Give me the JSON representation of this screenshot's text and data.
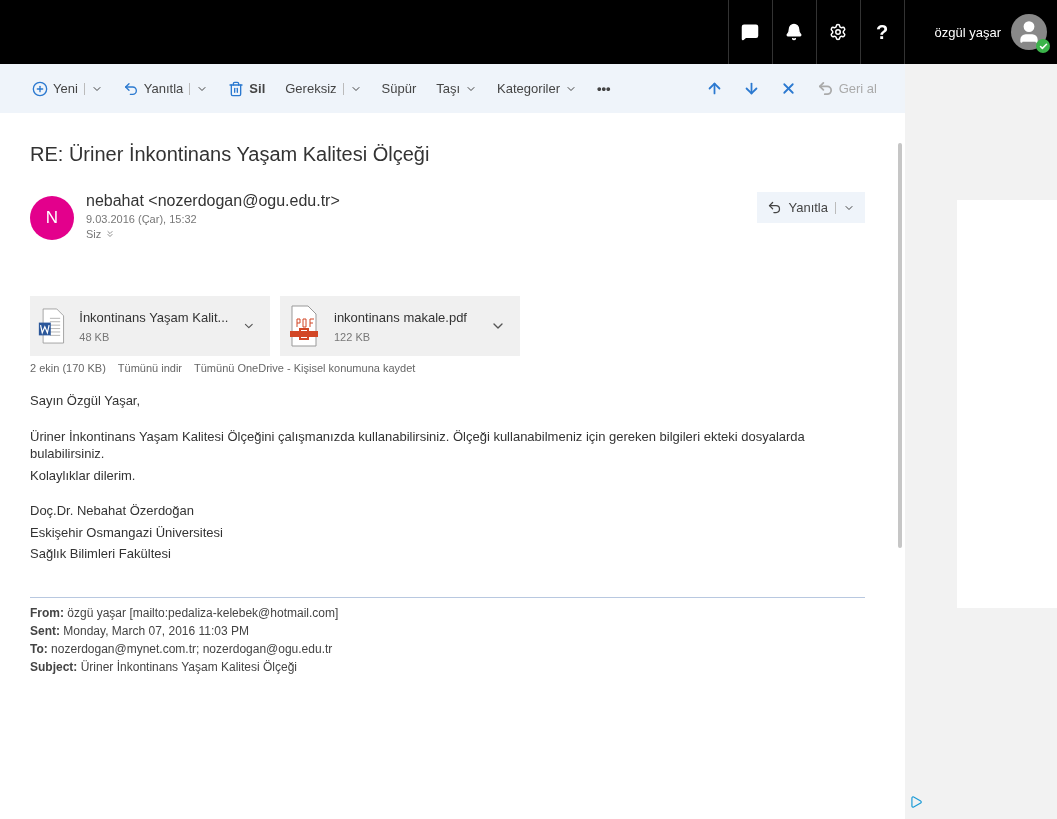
{
  "top_bar": {
    "buttons": [
      {
        "kind": "chat"
      },
      {
        "kind": "bell"
      },
      {
        "kind": "gear"
      },
      {
        "kind": "help",
        "text": "?"
      }
    ],
    "user_name": "özgül yaşar",
    "online": true
  },
  "toolbar": {
    "items": [
      {
        "kind": "new",
        "label": "Yeni",
        "has_menu": true,
        "split": true
      },
      {
        "kind": "reply",
        "label": "Yanıtla",
        "has_menu": true,
        "split": true
      },
      {
        "kind": "delete",
        "label": "Sil",
        "has_menu": false,
        "split": false
      },
      {
        "kind": "plain",
        "label": "Gereksiz",
        "has_menu": true,
        "split": true
      },
      {
        "kind": "plain",
        "label": "Süpür",
        "has_menu": false,
        "split": false
      },
      {
        "kind": "plain",
        "label": "Taşı",
        "has_menu": true,
        "split": false
      },
      {
        "kind": "plain",
        "label": "Kategoriler",
        "has_menu": true,
        "split": false
      },
      {
        "kind": "plain",
        "label": "•••",
        "has_menu": false,
        "split": false
      }
    ],
    "nav": [
      {
        "kind": "up",
        "disabled": false
      },
      {
        "kind": "down",
        "disabled": false
      },
      {
        "kind": "close",
        "disabled": false
      },
      {
        "kind": "undo",
        "label": "Geri al",
        "disabled": true
      }
    ]
  },
  "message": {
    "subject": "RE: Üriner İnkontinans Yaşam Kalitesi Ölçeği",
    "sender": {
      "initial": "N",
      "from": "nebahat <nozerdogan@ogu.edu.tr>",
      "date": "9.03.2016 (Çar), 15:32",
      "to": "Siz"
    },
    "reply_button": "Yanıtla",
    "attachments": [
      {
        "kind": "word",
        "name": "İnkontinans Yaşam Kalit...",
        "size": "48 KB"
      },
      {
        "kind": "pdf",
        "name": "inkontinans makale.pdf",
        "size": "122 KB"
      }
    ],
    "attachment_summary": "2 ekin (170 KB)",
    "attachment_actions": [
      "Tümünü indir",
      "Tümünü OneDrive - Kişisel konumuna kaydet"
    ],
    "body": [
      [
        "Sayın Özgül Yaşar,"
      ],
      [
        "Üriner İnkontinans Yaşam Kalitesi Ölçeğini çalışmanızda kullanabilirsiniz. Ölçeği kullanabilmeniz için gereken bilgileri ekteki dosyalarda bulabilirsiniz.",
        "Kolaylıklar dilerim."
      ],
      [
        "Doç.Dr. Nebahat Özerdoğan",
        "Eskişehir Osmangazi Üniversitesi",
        "Sağlık Bilimleri Fakültesi"
      ]
    ],
    "quoted_header": [
      {
        "label": "From:",
        "value": "özgü yaşar [mailto:pedaliza-kelebek@hotmail.com]"
      },
      {
        "label": "Sent:",
        "value": "Monday, March 07, 2016 11:03 PM"
      },
      {
        "label": "To:",
        "value": "nozerdogan@mynet.com.tr; nozerdogan@ogu.edu.tr"
      },
      {
        "label": "Subject:",
        "value": "Üriner İnkontinans Yaşam Kalitesi Ölçeği"
      }
    ]
  }
}
